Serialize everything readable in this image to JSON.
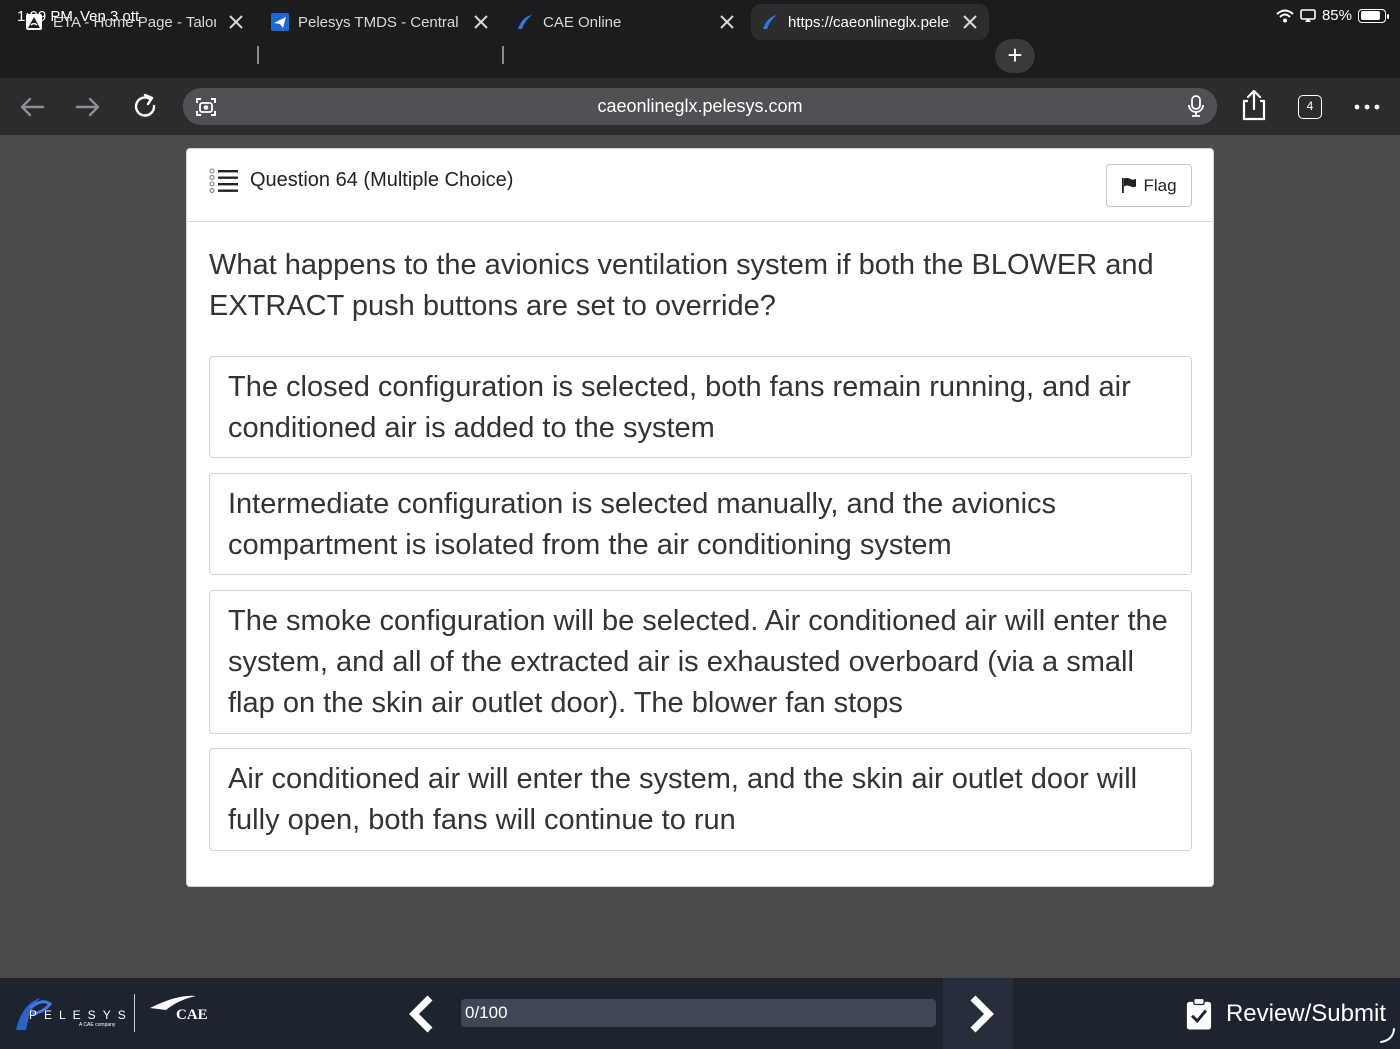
{
  "status": {
    "time": "1:09 PM",
    "date": "Ven 3 ott",
    "battery": "85%",
    "battery_level": 0.85
  },
  "tabs": [
    {
      "title": "ETA - Home Page - Talon",
      "icon": "eta-favicon-icon"
    },
    {
      "title": "Pelesys TMDS - Central",
      "icon": "pelesys-plane-favicon-icon"
    },
    {
      "title": "CAE Online",
      "icon": "cae-favicon-icon"
    },
    {
      "title": "https://caeonlineglx.pelesys.com",
      "icon": "cae-favicon-icon",
      "active": true
    }
  ],
  "toolbar": {
    "url": "caeonlineglx.pelesys.com",
    "tab_count": "4"
  },
  "question": {
    "title": "Question 64 (Multiple Choice)",
    "flag_label": "Flag",
    "text": "What happens to the avionics ventilation system if both the BLOWER and EXTRACT push buttons are set to override?",
    "options": [
      "The closed configuration is selected, both fans remain running, and air conditioned air is added to the system",
      "Intermediate configuration is selected manually, and the avionics compartment is isolated from the air conditioning system",
      "The smoke configuration will be selected. Air conditioned air will enter the system, and all of the extracted air is exhausted overboard (via a small flap on the skin air outlet door). The blower fan stops",
      "Air conditioned air will enter the system, and the skin air outlet door will fully open, both fans will continue to run"
    ]
  },
  "footer": {
    "pelesys_logo_text": "PELESYS",
    "pelesys_sub": "A CAE company",
    "cae_logo_text": "CAE",
    "progress_text": "0/100",
    "progress_value": 0,
    "review_label": "Review/Submit"
  },
  "colors": {
    "accent": "#1a6ad1",
    "bottombar": "#1d2430",
    "page_bg": "#4a4a4a"
  }
}
